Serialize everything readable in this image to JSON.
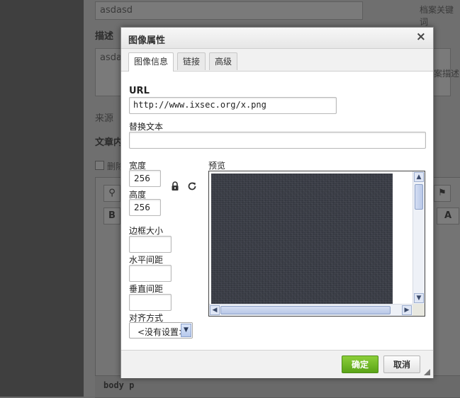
{
  "background": {
    "title_field_value": "asdasd",
    "keyword_hint": "档案关键词",
    "desc_label": "描述",
    "desc_value": "asda",
    "desc_hint": "案描述",
    "source_label": "来源",
    "content_label": "文章内",
    "checkbox_label": "删除",
    "status_path": "body  p"
  },
  "dialog": {
    "title": "图像属性",
    "close_glyph": "×",
    "tabs": [
      {
        "label": "图像信息",
        "active": true
      },
      {
        "label": "链接",
        "active": false
      },
      {
        "label": "高级",
        "active": false
      }
    ],
    "url_label": "URL",
    "url_value": "http://www.ixsec.org/x.png",
    "alt_label": "替换文本",
    "alt_value": "",
    "width_label": "宽度",
    "width_value": "256",
    "height_label": "高度",
    "height_value": "256",
    "border_label": "边框大小",
    "border_value": "",
    "hspace_label": "水平间距",
    "hspace_value": "",
    "vspace_label": "垂直间距",
    "vspace_value": "",
    "align_label": "对齐方式",
    "align_selected": "<没有设置>",
    "preview_label": "预览",
    "ok_label": "确定",
    "cancel_label": "取消"
  }
}
